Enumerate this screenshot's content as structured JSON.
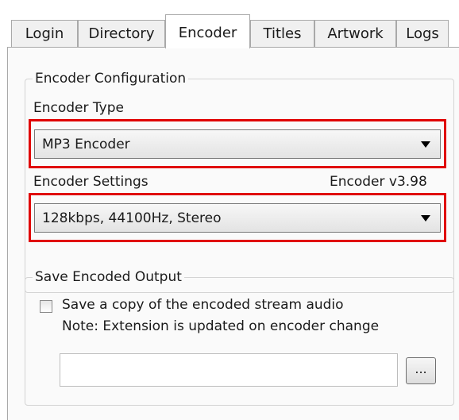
{
  "tabs": [
    {
      "label": "Login"
    },
    {
      "label": "Directory"
    },
    {
      "label": "Encoder"
    },
    {
      "label": "Titles"
    },
    {
      "label": "Artwork"
    },
    {
      "label": "Logs"
    }
  ],
  "active_tab": "Encoder",
  "encoder_config": {
    "group_title": "Encoder Configuration",
    "type_label": "Encoder Type",
    "type_value": "MP3 Encoder",
    "settings_label": "Encoder Settings",
    "version": "Encoder v3.98",
    "settings_value": "128kbps, 44100Hz, Stereo"
  },
  "save_output": {
    "group_title": "Save Encoded Output",
    "checkbox_label": "Save a copy of the encoded stream audio",
    "checked": false,
    "note": "Note: Extension is updated on encoder change",
    "path_value": "",
    "browse_label": "..."
  },
  "colors": {
    "highlight": "#e00000",
    "panel_bg": "#fafafa"
  }
}
